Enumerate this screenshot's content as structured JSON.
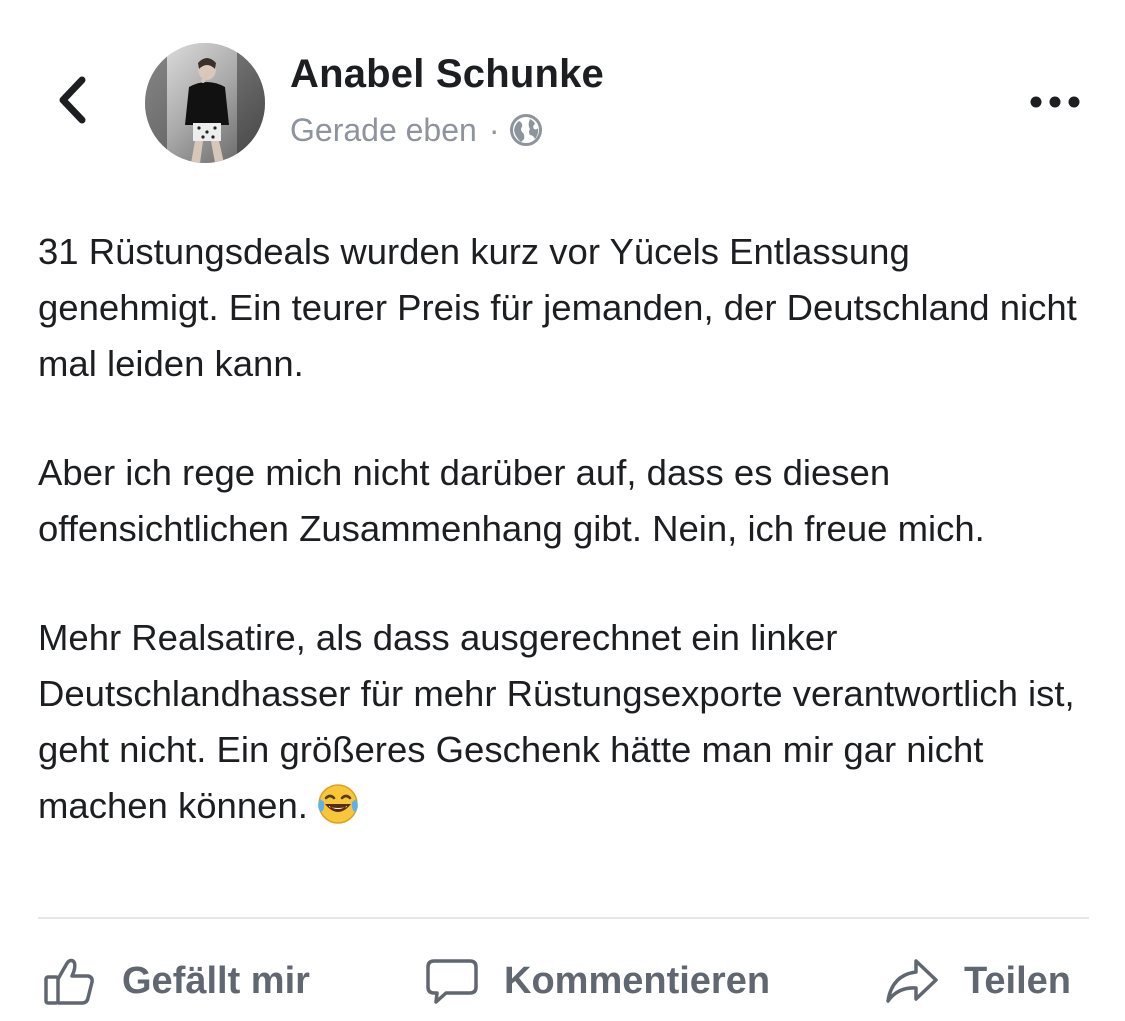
{
  "post": {
    "author_name": "Anabel Schunke",
    "timestamp": "Gerade eben",
    "separator": "·",
    "audience_icon": "globe-icon",
    "paragraphs": [
      "31 Rüstungsdeals wurden kurz vor Yücels Entlassung genehmigt. Ein teurer Preis für jemanden, der Deutschland nicht mal leiden kann.",
      "Aber ich rege mich nicht darüber auf, dass es diesen offensichtlichen Zusammenhang gibt. Nein, ich freue mich.",
      "Mehr Realsatire, als dass ausgerechnet ein linker Deutschlandhasser für mehr Rüstungsexporte verantwortlich ist, geht nicht. Ein größeres Geschenk hätte man mir gar nicht machen können."
    ],
    "trailing_emoji": "tears-of-joy-emoji"
  },
  "actions": {
    "like_label": "Gefällt mir",
    "comment_label": "Kommentieren",
    "share_label": "Teilen"
  },
  "icons": {
    "back": "chevron-left-icon",
    "more": "more-options-icon",
    "like": "thumbs-up-icon",
    "comment": "comment-icon",
    "share": "share-icon"
  },
  "colors": {
    "text": "#1c1e21",
    "meta": "#8d949e",
    "action": "#606770",
    "divider": "#e4e6eb"
  }
}
